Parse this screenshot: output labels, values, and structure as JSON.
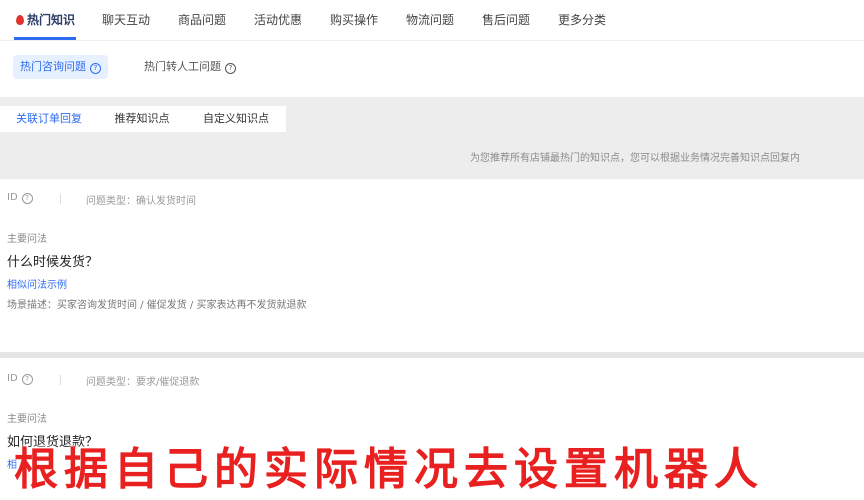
{
  "top_tabs": [
    "热门知识",
    "聊天互动",
    "商品问题",
    "活动优惠",
    "购买操作",
    "物流问题",
    "售后问题",
    "更多分类"
  ],
  "sub_tabs": {
    "active": "热门咨询问题",
    "other": "热门转人工问题"
  },
  "inner_tabs": [
    "关联订单回复",
    "推荐知识点",
    "自定义知识点"
  ],
  "hint": "为您推荐所有店铺最热门的知识点，您可以根据业务情况完善知识点回复内",
  "cards": [
    {
      "id_label": "ID",
      "type": "问题类型：确认发货时间",
      "main_label": "主要问法",
      "question": "什么时候发货？",
      "similar_link": "相似问法示例",
      "scene": "场景描述：买家咨询发货时间 / 催促发货 / 买家表达再不发货就退款"
    },
    {
      "id_label": "ID",
      "type": "问题类型：要求/催促退款",
      "main_label": "主要问法",
      "question": "如何退货退款？",
      "similar_link": "相"
    }
  ],
  "subtitle": "根据自己的实际情况去设置机器人",
  "colors": {
    "accent": "#2d6cf0",
    "subtitle": "#e8201f",
    "hot_icon": "#e0322e"
  }
}
